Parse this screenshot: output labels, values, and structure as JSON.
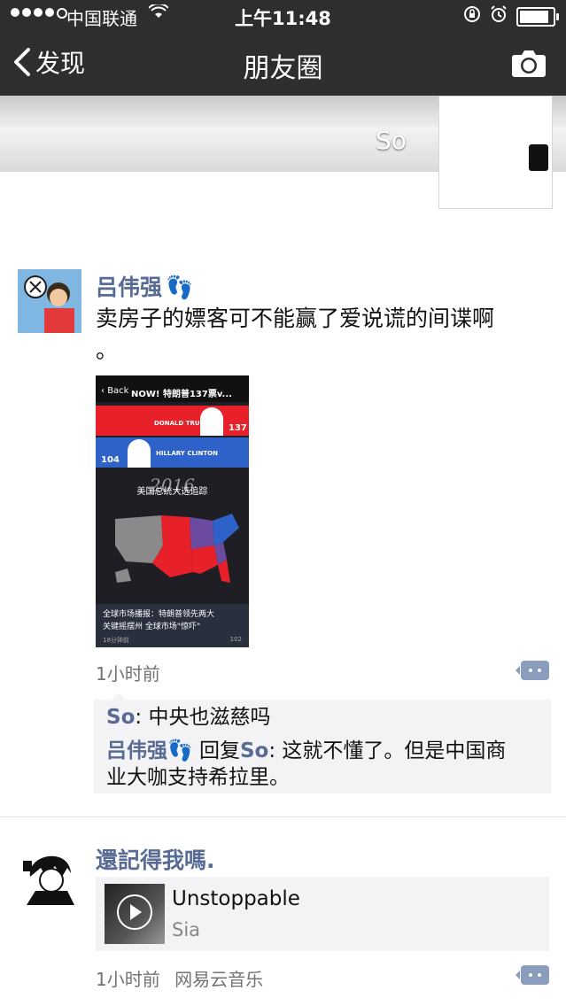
{
  "status": {
    "carrier": "中国联通",
    "time": "上午11:48",
    "battery_level": 0.95
  },
  "nav": {
    "back_label": "发现",
    "title": "朋友圈"
  },
  "cover": {
    "name": "So"
  },
  "post1": {
    "user": "吕伟强",
    "emoji": "👣",
    "text_line1": "卖房子的嫖客可不能赢了爱说谎的间谍啊",
    "text_line2": "。",
    "image": {
      "nav_back": "Back",
      "nav_title": "NOW! 特朗普137票v...",
      "trump_name": "DONALD TRUMP",
      "trump_votes": "137",
      "clinton_name": "HILLARY CLINTON",
      "clinton_votes": "104",
      "year": "2016",
      "headline_cn": "美国总统大选追踪",
      "caption_line1": "全球市场播报：特朗普领先两大",
      "caption_line2": "关键摇摆州 全球市场\"惊吓\"",
      "caption_time": "18分钟前",
      "caption_count": "102",
      "colors": {
        "red": "#e8202a",
        "blue": "#2f62c9",
        "purple": "#6b4aa0",
        "bg": "#1e1e24"
      }
    },
    "time": "1小时前",
    "comments": [
      {
        "user": "So",
        "text": "中央也滋慈吗"
      },
      {
        "user": "吕伟强",
        "emoji": "👣",
        "reply_word": "回复",
        "reply_to": "So",
        "text_line1": "这就不懂了。但是中国商",
        "text_line2": "业大咖支持希拉里。"
      }
    ]
  },
  "post2": {
    "user": "還記得我嗎.",
    "music": {
      "title": "Unstoppable",
      "artist": "Sia"
    },
    "time": "1小时前",
    "source": "网易云音乐"
  },
  "colors": {
    "nav_bg": "#2e2e2e",
    "link": "#576b95",
    "comment_bg": "#f3f3f5"
  }
}
